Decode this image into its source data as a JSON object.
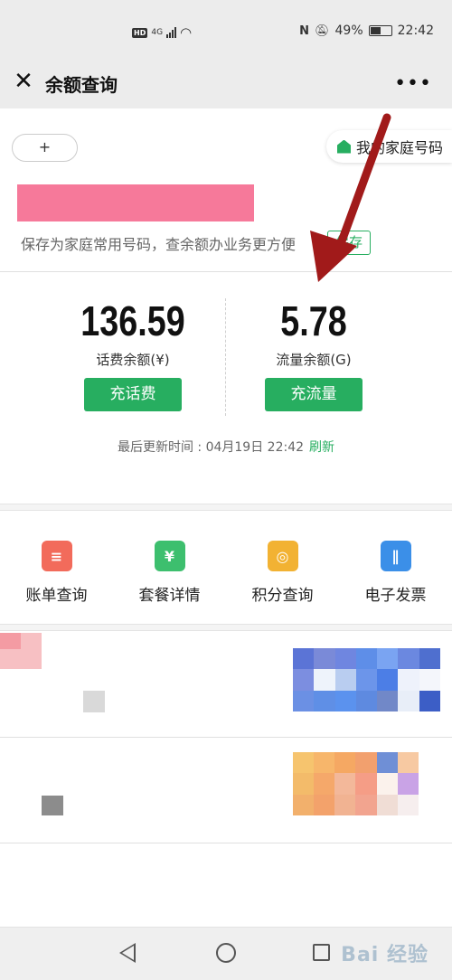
{
  "status_bar": {
    "network_hd": "HD",
    "network_gen": "4G",
    "battery": "49%",
    "time": "22:42"
  },
  "app_bar": {
    "title": "余额查询",
    "close_glyph": "✕",
    "more_glyph": "•••"
  },
  "account": {
    "add_label": "+",
    "family_tag": "我的家庭号码",
    "save_hint": "保存为家庭常用号码，查余额办业务更方便",
    "save_button": "保存"
  },
  "balances": [
    {
      "value": "136.59",
      "label": "话费余额(¥)",
      "button": "充话费"
    },
    {
      "value": "5.78",
      "label": "流量余额(G)",
      "button": "充流量"
    }
  ],
  "update": {
    "text": "最后更新时间 : 04月19日 22:42",
    "refresh": "刷新"
  },
  "shortcuts": [
    {
      "label": "账单查询",
      "icon": "bill-icon",
      "glyph": "≡",
      "color": "#f26b5b"
    },
    {
      "label": "套餐详情",
      "icon": "package-icon",
      "glyph": "¥",
      "color": "#3dbf6e"
    },
    {
      "label": "积分查询",
      "icon": "points-icon",
      "glyph": "◎",
      "color": "#f2b233"
    },
    {
      "label": "电子发票",
      "icon": "invoice-icon",
      "glyph": "∥",
      "color": "#3b8fe8"
    }
  ],
  "nav": {
    "watermark": "Bai 经验"
  },
  "colors": {
    "accent": "#27ae60",
    "redaction": "#f6799a",
    "annotation": "#a11a1a"
  }
}
